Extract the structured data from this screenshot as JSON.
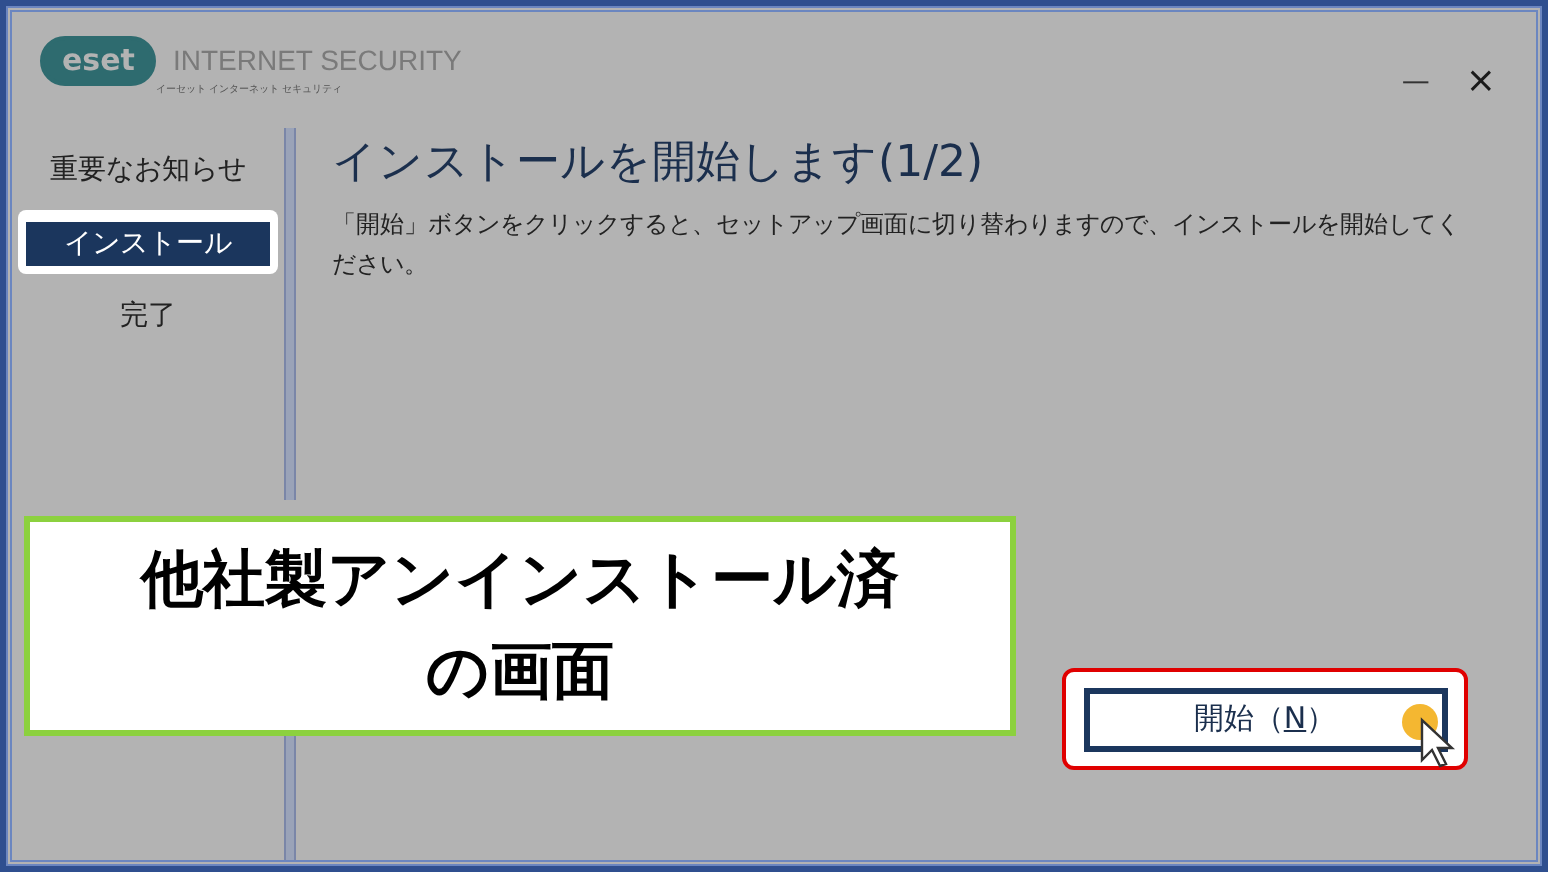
{
  "window": {
    "logo": "eset",
    "product": "INTERNET SECURITY",
    "logo_subtitle": "イーセット インターネット セキュリティ",
    "minimize": "—",
    "close": "×"
  },
  "sidebar": {
    "items": [
      {
        "label": "重要なお知らせ",
        "selected": false
      },
      {
        "label": "インストール",
        "selected": true
      },
      {
        "label": "完了",
        "selected": false
      }
    ]
  },
  "content": {
    "title": "インストールを開始します(1/2)",
    "description": "「開始」ボタンをクリックすると、セットアップ画面に切り替わりますので、インストールを開始してください。"
  },
  "start_button": {
    "label_prefix": "開始（",
    "access_key": "N",
    "label_suffix": "）"
  },
  "caption": {
    "lines": [
      "他社製アンインストール済",
      "の画面"
    ]
  }
}
